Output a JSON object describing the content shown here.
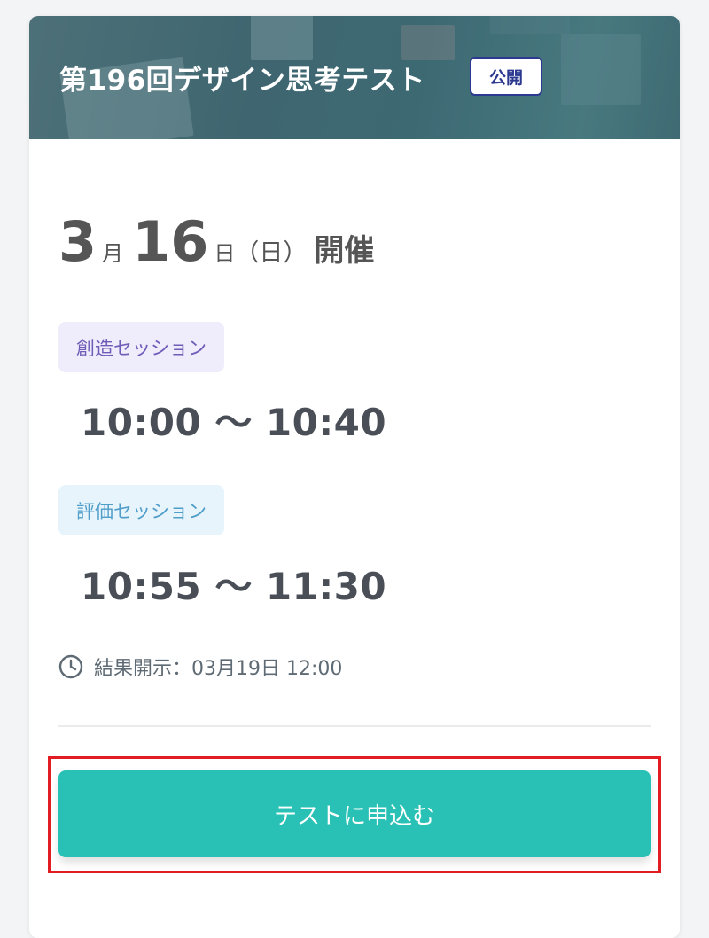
{
  "event": {
    "title": "第196回デザイン思考テスト",
    "status_badge": "公開"
  },
  "date": {
    "month": "3",
    "month_unit": "月",
    "day": "16",
    "day_unit": "日",
    "weekday": "（日）",
    "suffix": "開催"
  },
  "sessions": [
    {
      "label": "創造セッション",
      "time": "10:00 〜 10:40",
      "accent": "#6f5bb8",
      "background": "#efecfb"
    },
    {
      "label": "評価セッション",
      "time": "10:55 〜 11:30",
      "accent": "#4f9ec9",
      "background": "#e7f4fc"
    }
  ],
  "result": {
    "icon": "clock-icon",
    "text": "結果開示：03月19日 12:00"
  },
  "apply_button": {
    "label": "テストに申込む",
    "color": "#29c1b5"
  },
  "colors": {
    "highlight": "#e31c23",
    "badge_border": "#2b3990"
  }
}
